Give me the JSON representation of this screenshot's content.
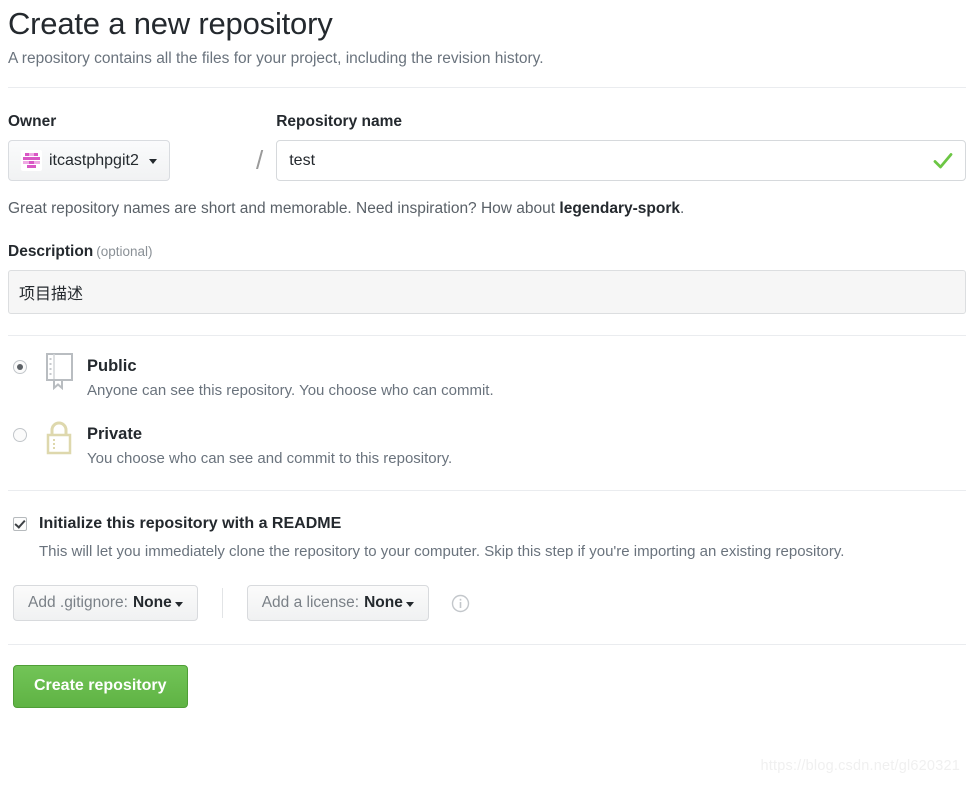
{
  "header": {
    "title": "Create a new repository",
    "subtitle": "A repository contains all the files for your project, including the revision history."
  },
  "owner": {
    "label": "Owner",
    "name": "itcastphpgit2",
    "avatar_icon": "identicon-avatar",
    "caret_icon": "chevron-down-icon",
    "separator": "/"
  },
  "repository_name": {
    "label": "Repository name",
    "value": "test",
    "placeholder": "",
    "valid_icon": "check-icon"
  },
  "hint": {
    "prefix": "Great repository names are short and memorable. Need inspiration? How about ",
    "suggestion": "legendary-spork",
    "suffix": "."
  },
  "description": {
    "label": "Description",
    "optional": "(optional)",
    "value": "项目描述",
    "placeholder": ""
  },
  "visibility": {
    "options": [
      {
        "title": "Public",
        "description": "Anyone can see this repository. You choose who can commit.",
        "icon": "repo-book-icon",
        "selected": true
      },
      {
        "title": "Private",
        "description": "You choose who can see and commit to this repository.",
        "icon": "lock-icon",
        "selected": false
      }
    ]
  },
  "readme": {
    "title": "Initialize this repository with a README",
    "description": "This will let you immediately clone the repository to your computer. Skip this step if you're importing an existing repository.",
    "checked": true
  },
  "gitignore": {
    "label": "Add .gitignore:",
    "value": "None",
    "caret_icon": "chevron-down-icon"
  },
  "license": {
    "label": "Add a license:",
    "value": "None",
    "caret_icon": "chevron-down-icon",
    "info_icon": "info-icon"
  },
  "submit": {
    "label": "Create repository"
  },
  "watermark": {
    "text": "https://blog.csdn.net/gl620321"
  },
  "colors": {
    "accent_green": "#6cc644",
    "button_green": "#60b544",
    "avatar_pink": "#d957c5",
    "lock_yellow": "#e3dcb4",
    "text_primary": "#24292e",
    "text_muted": "#6a737d",
    "rule": "#eaecef"
  }
}
